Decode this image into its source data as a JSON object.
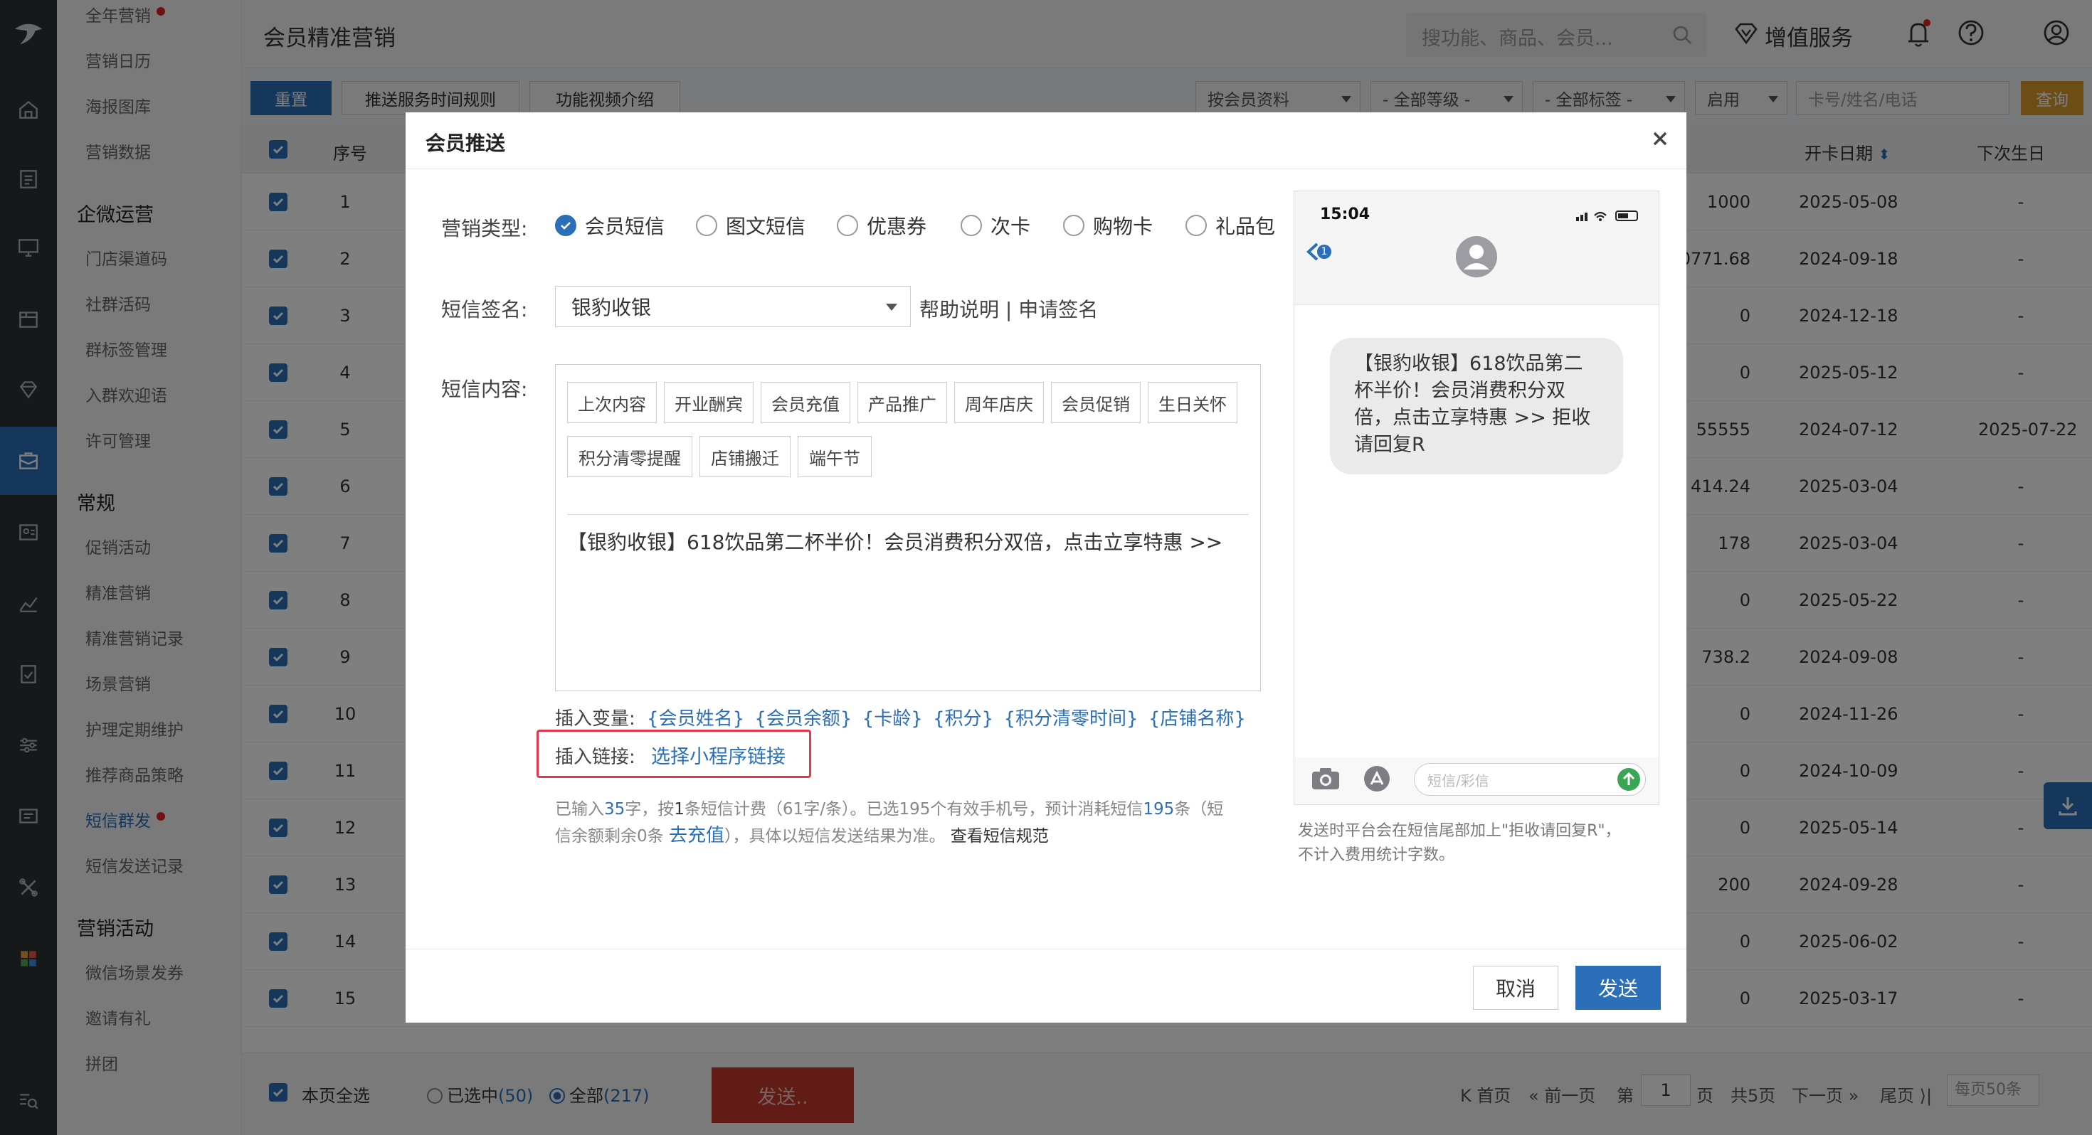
{
  "header": {
    "title": "会员精准营销",
    "search_placeholder": "搜功能、商品、会员...",
    "value_added": "增值服务"
  },
  "menu": {
    "items_top": [
      "全年营销",
      "营销日历",
      "海报图库",
      "营销数据"
    ],
    "group1": "企微运营",
    "group1_items": [
      "门店渠道码",
      "社群活码",
      "群标签管理",
      "入群欢迎语",
      "许可管理"
    ],
    "group2": "常规",
    "group2_items": [
      "促销活动",
      "精准营销",
      "精准营销记录",
      "场景营销",
      "护理定期维护",
      "推荐商品策略",
      "短信群发",
      "短信发送记录"
    ],
    "group3": "营销活动",
    "group3_items": [
      "微信场景发券",
      "邀请有礼",
      "拼团"
    ]
  },
  "toolbar": {
    "reset": "重置",
    "rule": "推送服务时间规则",
    "video": "功能视频介绍",
    "filter1": "按会员资料",
    "filter2": "- 全部等级 -",
    "filter3": "- 全部标签 -",
    "filter4": "启用",
    "card_placeholder": "卡号/姓名/电话",
    "query": "查询"
  },
  "table": {
    "col_seq": "序号",
    "col_open": "开卡日期",
    "col_birth": "下次生日",
    "rows": [
      {
        "n": "1",
        "v": "1000",
        "d": "2025-05-08",
        "b": "-"
      },
      {
        "n": "2",
        "v": "0771.68",
        "d": "2024-09-18",
        "b": "-"
      },
      {
        "n": "3",
        "v": "0",
        "d": "2024-12-18",
        "b": "-"
      },
      {
        "n": "4",
        "v": "0",
        "d": "2025-05-12",
        "b": "-"
      },
      {
        "n": "5",
        "v": "55555",
        "d": "2024-07-12",
        "b": "2025-07-22"
      },
      {
        "n": "6",
        "v": "414.24",
        "d": "2025-03-04",
        "b": "-"
      },
      {
        "n": "7",
        "v": "178",
        "d": "2025-03-04",
        "b": "-"
      },
      {
        "n": "8",
        "v": "0",
        "d": "2025-05-22",
        "b": "-"
      },
      {
        "n": "9",
        "v": "738.2",
        "d": "2024-09-08",
        "b": "-"
      },
      {
        "n": "10",
        "v": "0",
        "d": "2024-11-26",
        "b": "-"
      },
      {
        "n": "11",
        "v": "0",
        "d": "2024-10-09",
        "b": "-"
      },
      {
        "n": "12",
        "v": "0",
        "d": "2025-05-14",
        "b": "-"
      },
      {
        "n": "13",
        "v": "200",
        "d": "2024-09-28",
        "b": "-"
      },
      {
        "n": "14",
        "v": "0",
        "d": "2025-06-02",
        "b": "-"
      },
      {
        "n": "15",
        "v": "0",
        "d": "2025-03-17",
        "b": "-"
      }
    ]
  },
  "footer": {
    "select_page": "本页全选",
    "selected_label": "已选中",
    "selected_count": "(50)",
    "all_label": "全部",
    "all_count": "(217)",
    "send": "发送..",
    "first": "首页",
    "prev": "前一页",
    "page_pre": "第",
    "page": "1",
    "page_post": "页",
    "total": "共5页",
    "next": "下一页",
    "last": "尾页",
    "per_page": "每页50条"
  },
  "modal": {
    "title": "会员推送",
    "type_label": "营销类型:",
    "types": [
      "会员短信",
      "图文短信",
      "优惠券",
      "次卡",
      "购物卡",
      "礼品包"
    ],
    "sig_label": "短信签名:",
    "sig_value": "银豹收银",
    "help": "帮助说明 | 申请签名",
    "content_label": "短信内容:",
    "tags": [
      "上次内容",
      "开业酬宾",
      "会员充值",
      "产品推广",
      "周年店庆",
      "会员促销",
      "生日关怀",
      "积分清零提醒",
      "店铺搬迁",
      "端午节"
    ],
    "message": "【银豹收银】618饮品第二杯半价！会员消费积分双倍，点击立享特惠 >>",
    "var_label": "插入变量:",
    "vars": [
      "{会员姓名}",
      "{会员余额}",
      "{卡龄}",
      "{积分}",
      "{积分清零时间}",
      "{店铺名称}"
    ],
    "link_label": "插入链接:",
    "link_value": "选择小程序链接",
    "stats1_a": "已输入",
    "stats1_chars": "35",
    "stats1_b": "字，按",
    "stats1_count": "1",
    "stats1_c": "条短信计费（61字/条）。已选195个有效手机号，预计消耗短信",
    "stats1_total": "195",
    "stats1_d": "条（短",
    "stats2_a": "信余额剩余0条",
    "recharge": "去充值",
    "stats2_b": "），具体以短信发送结果为准。",
    "rules": "查看短信规范",
    "preview_time": "15:04",
    "preview_badge": "1",
    "preview_msg": "【银豹收银】618饮品第二杯半价！会员消费积分双倍，点击立享特惠 >> 拒收请回复R",
    "preview_input": "短信/彩信",
    "note1": "发送时平台会在短信尾部加上\"拒收请回复R\"，",
    "note2": "不计入费用统计字数。",
    "cancel": "取消",
    "send": "发送"
  },
  "colors": {
    "primary": "#2a6fb8",
    "rail": "#2f3035",
    "danger": "#c0392b",
    "highlight": "#e03a4a"
  }
}
